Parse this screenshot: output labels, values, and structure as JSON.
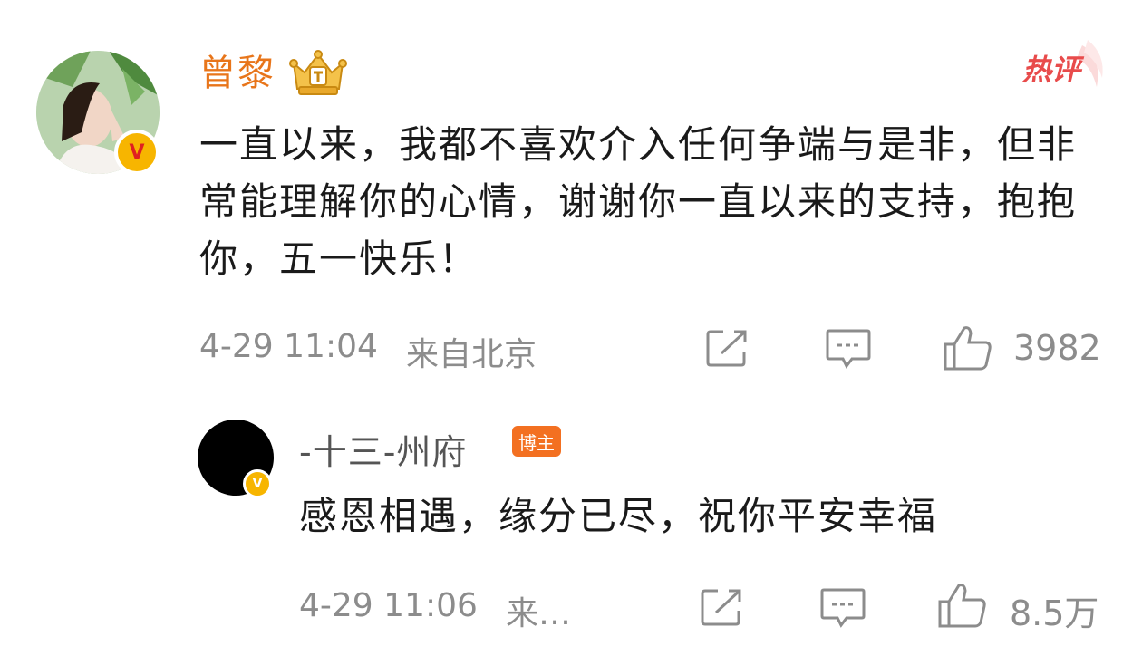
{
  "comment": {
    "user_name": "曾黎",
    "hot_label": "热评",
    "text": "一直以来，我都不喜欢介入任何争端与是非，但非常能理解你的心情，谢谢你一直以来的支持，抱抱你，五一快乐！",
    "time": "4-29 11:04",
    "location": "来自北京",
    "like_count": "3982",
    "verified_mark": "V"
  },
  "reply": {
    "user_name": "-十三-州府",
    "badge": "博主",
    "text": "感恩相遇，缘分已尽，祝你平安幸福",
    "time": "4-29 11:06",
    "location_truncated": "来…",
    "like_count": "8.5万",
    "verified_mark": "V"
  },
  "colors": {
    "username": "#e8751a",
    "meta_gray": "#8c8c8c",
    "blogger_badge": "#f37021",
    "verified_gold": "#f7b500",
    "hot_red": "#e84b4b"
  },
  "icons": [
    "crown-icon",
    "hot-comment-icon",
    "share-icon",
    "comment-icon",
    "like-icon"
  ]
}
